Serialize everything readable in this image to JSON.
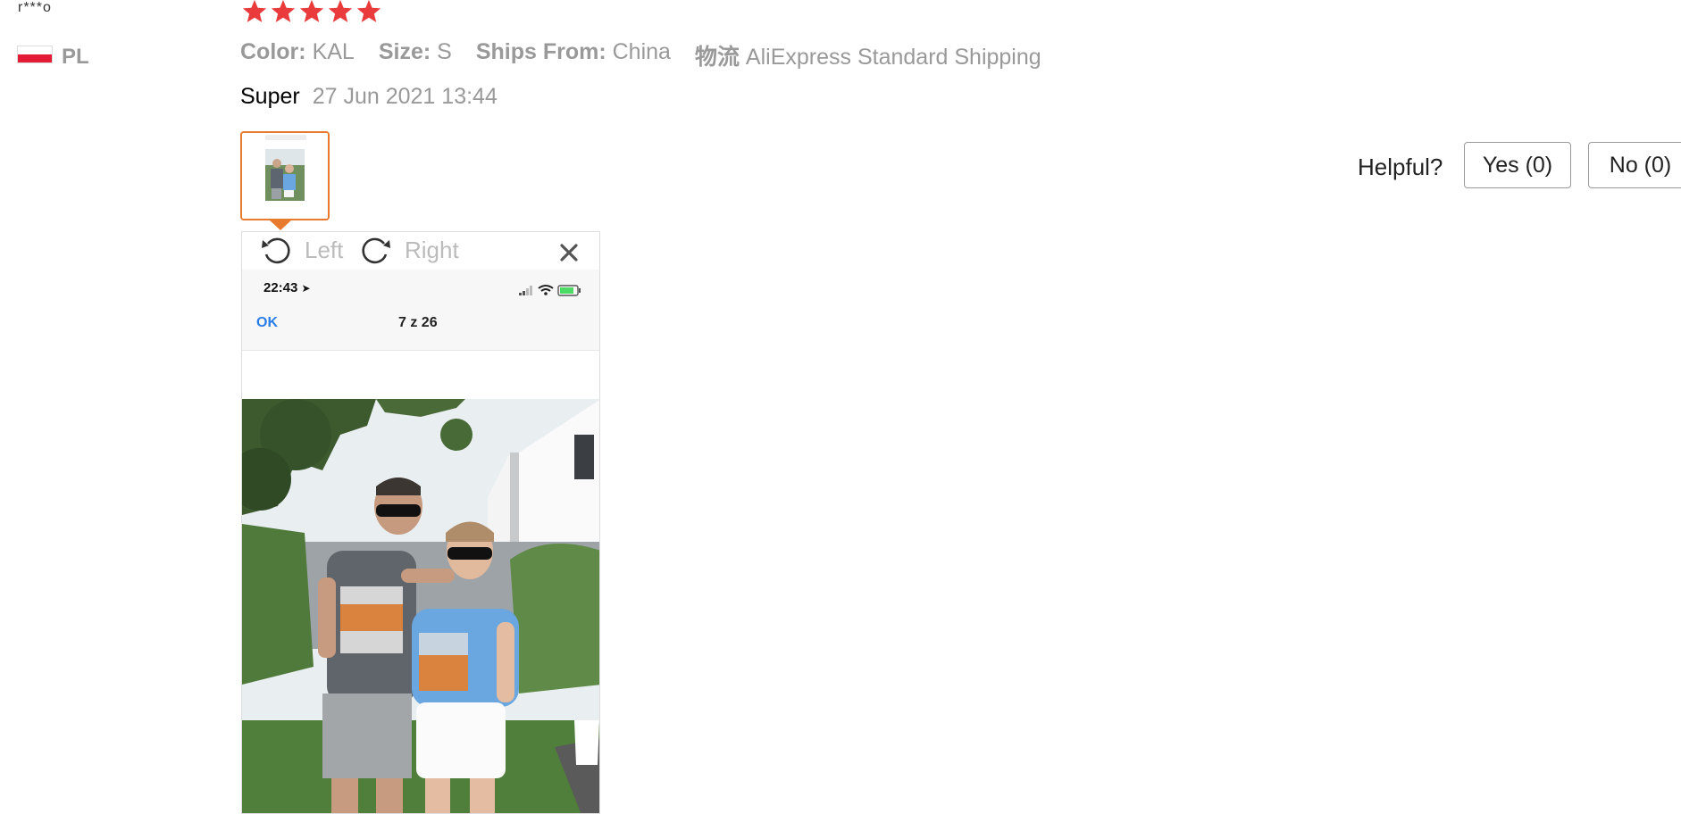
{
  "review": {
    "user_name": "r***o",
    "country_code": "PL",
    "rating": 5,
    "attributes": [
      {
        "key": "Color:",
        "value": "KAL"
      },
      {
        "key": "Size:",
        "value": "S"
      },
      {
        "key": "Ships From:",
        "value": "China"
      },
      {
        "key": "物流",
        "value": "AliExpress Standard Shipping"
      }
    ],
    "text": "Super",
    "date": "27 Jun 2021 13:44"
  },
  "viewer": {
    "rotate_left_label": "Left",
    "rotate_right_label": "Right",
    "photo": {
      "status_time": "22:43",
      "nav_ok": "OK",
      "nav_count": "7 z 26"
    }
  },
  "helpful": {
    "label": "Helpful?",
    "yes_label": "Yes (0)",
    "no_label": "No (0)"
  },
  "colors": {
    "star": "#e93b3b",
    "thumb_border": "#e87a2e",
    "muted_text": "#999999",
    "link_blue": "#2b7de9"
  },
  "icons": {
    "star": "star-icon",
    "rotate_left": "rotate-left-icon",
    "rotate_right": "rotate-right-icon",
    "close": "close-icon",
    "flag": "poland-flag-icon"
  }
}
